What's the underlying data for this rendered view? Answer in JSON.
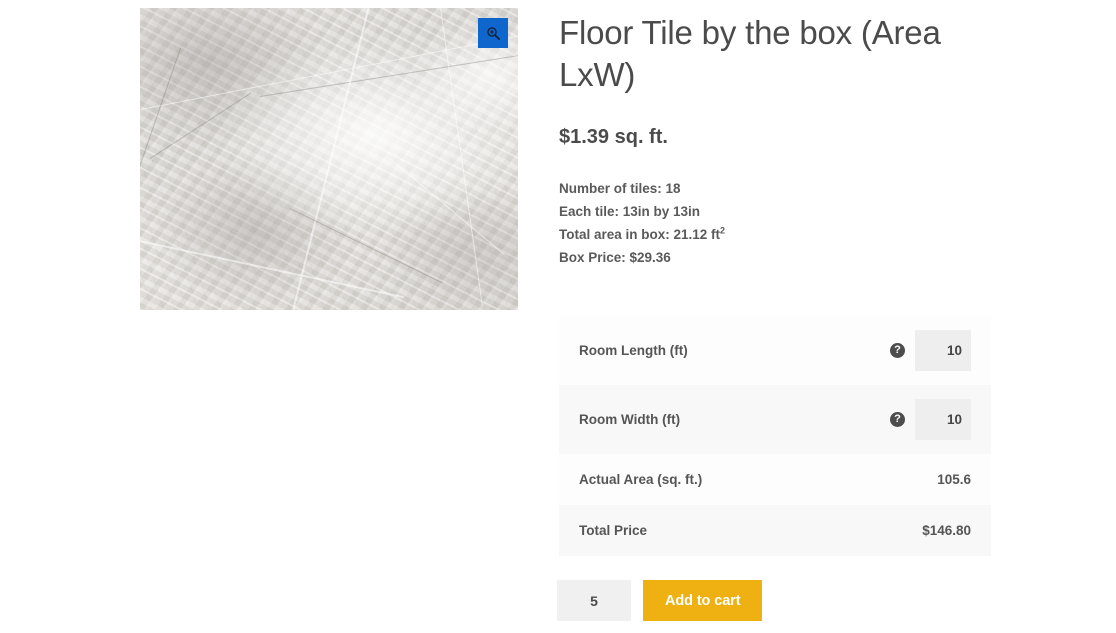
{
  "gallery": {
    "image_alt": "Gray marble floor tile texture",
    "zoom_button_label": "⊕",
    "zoom_icon_name": "magnifier-plus-icon"
  },
  "product": {
    "title": "Floor Tile by the box (Area LxW)",
    "price": "$1.39 sq. ft.",
    "description": {
      "tiles_count": "Number of tiles: 18",
      "tile_size": "Each tile: 13in by 13in",
      "total_area_label": "Total area in box: 21.12 ft",
      "total_area_exponent": "2",
      "box_price": "Box Price: $29.36"
    }
  },
  "calculator": {
    "rows": [
      {
        "label": "Room Length (ft)",
        "value": "10",
        "has_help": true,
        "is_input": true
      },
      {
        "label": "Room Width (ft)",
        "value": "10",
        "has_help": true,
        "is_input": true
      },
      {
        "label": "Actual Area (sq. ft.)",
        "value": "105.6",
        "has_help": false,
        "is_input": false
      },
      {
        "label": "Total Price",
        "value": "$146.80",
        "has_help": false,
        "is_input": false
      }
    ],
    "help_glyph": "?"
  },
  "cart": {
    "quantity": "5",
    "add_to_cart_label": "Add to cart"
  },
  "colors": {
    "accent_button": "#efb111",
    "zoom_button": "#0f66cc",
    "text": "#4a4a4a",
    "input_background": "#eeeeee"
  }
}
